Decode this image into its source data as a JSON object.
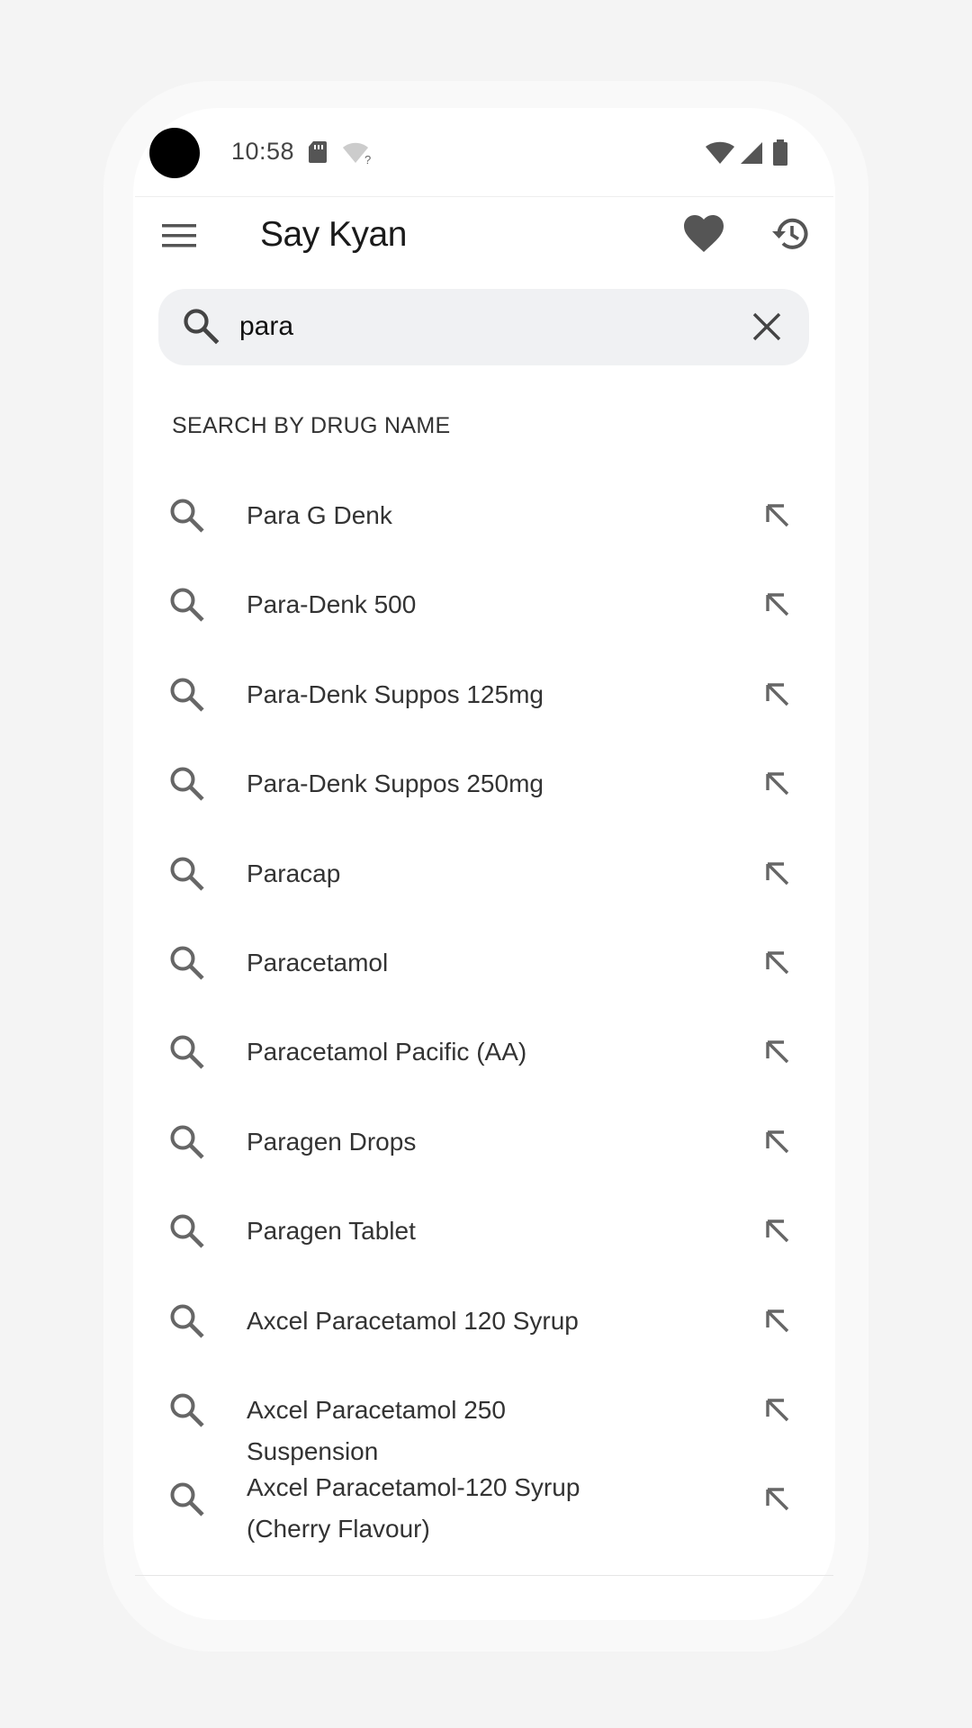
{
  "status_bar": {
    "time": "10:58",
    "icons": [
      "sd-card-icon",
      "wifi-question-icon",
      "wifi-icon",
      "cell-signal-icon",
      "battery-icon"
    ]
  },
  "app_bar": {
    "title": "Say Kyan",
    "icons": [
      "menu-icon",
      "heart-icon",
      "history-icon"
    ]
  },
  "search": {
    "value": "para",
    "placeholder": ""
  },
  "section_header": "SEARCH BY DRUG NAME",
  "results": [
    {
      "label": "Para G Denk"
    },
    {
      "label": "Para-Denk 500"
    },
    {
      "label": "Para-Denk Suppos 125mg"
    },
    {
      "label": "Para-Denk Suppos 250mg"
    },
    {
      "label": "Paracap"
    },
    {
      "label": "Paracetamol"
    },
    {
      "label": "Paracetamol Pacific (AA)"
    },
    {
      "label": "Paragen Drops"
    },
    {
      "label": "Paragen Tablet"
    },
    {
      "label": "Axcel Paracetamol 120 Syrup"
    },
    {
      "label": "Axcel Paracetamol 250 Suspension"
    },
    {
      "label": "Axcel Paracetamol-120 Syrup (Cherry Flavour)"
    }
  ],
  "colors": {
    "background": "#f4f4f4",
    "screen": "#ffffff",
    "search_bar": "#f0f1f3",
    "icon_gray": "#666666",
    "text_dark": "#1a1a1a"
  }
}
